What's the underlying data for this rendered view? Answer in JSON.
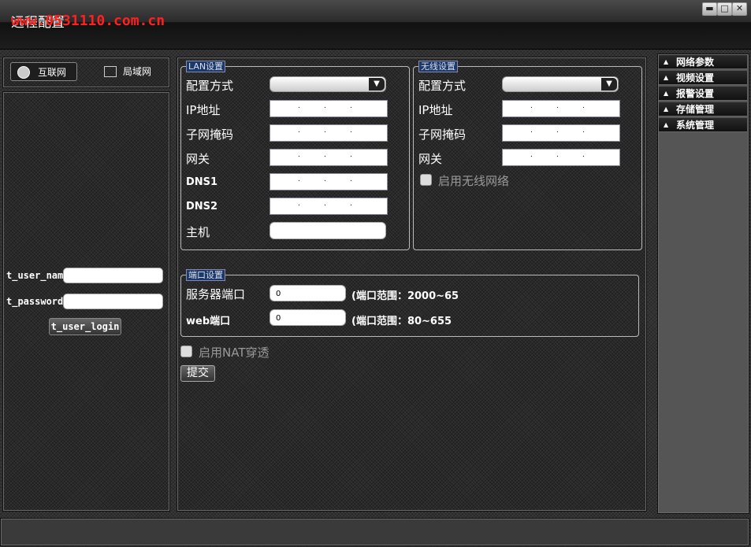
{
  "window": {
    "title": "远程配置",
    "watermark": "www.0531110.com.cn",
    "buttons": {
      "minimize": "▬",
      "maximize": "□",
      "close": "✕"
    }
  },
  "left": {
    "tabs": [
      {
        "label": "互联网"
      },
      {
        "label": "局域网"
      }
    ],
    "login": {
      "username_label": "t_user_name",
      "password_label": "t_password",
      "login_button": "t_user_login"
    }
  },
  "lan": {
    "legend": "LAN设置",
    "fields": {
      "mode": "配置方式",
      "ip": "IP地址",
      "mask": "子网掩码",
      "gateway": "网关",
      "dns1": "DNS1",
      "dns2": "DNS2",
      "host": "主机"
    }
  },
  "wireless": {
    "legend": "无线设置",
    "fields": {
      "mode": "配置方式",
      "ip": "IP地址",
      "mask": "子网掩码",
      "gateway": "网关"
    },
    "enable_label": "启用无线网络"
  },
  "ports": {
    "legend": "端口设置",
    "server_port_label": "服务器端口",
    "server_port_value": "0",
    "server_port_range": "(端口范围：2000~65",
    "web_port_label": "web端口",
    "web_port_value": "0",
    "web_port_range": "(端口范围：80~655"
  },
  "nat_label": "启用NAT穿透",
  "submit_label": "提交",
  "ip_dot": ".",
  "select_arrow": "▼",
  "menu": [
    {
      "label": "网络参数"
    },
    {
      "label": "视频设置"
    },
    {
      "label": "报警设置"
    },
    {
      "label": "存储管理"
    },
    {
      "label": "系统管理"
    }
  ],
  "menu_marker": "▲"
}
